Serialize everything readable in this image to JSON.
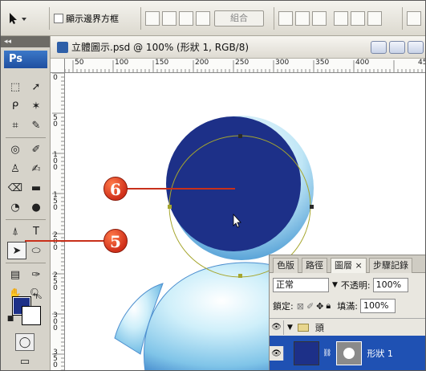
{
  "options_bar": {
    "show_bounding_box_label": "顯示邊界方框",
    "combine_label": "組合"
  },
  "document": {
    "title": "立體圖示.psd @ 100% (形狀 1, RGB/8)",
    "ruler_h_labels": [
      "50",
      "100",
      "150",
      "200",
      "250",
      "300",
      "350",
      "400",
      "45"
    ],
    "ruler_v_labels": [
      "0",
      "5\n0",
      "1\n0\n0",
      "1\n5\n0",
      "2\n0\n0",
      "2\n5\n0",
      "3\n0\n0",
      "3\n5\n0"
    ]
  },
  "toolbox": {
    "app_label": "Ps"
  },
  "colors": {
    "foreground": "#1d3088",
    "background": "#ffffff",
    "shape_fill": "#1d3088",
    "callout": "#d0301a"
  },
  "layers_panel": {
    "tabs": [
      "色版",
      "路徑",
      "圖層 ×",
      "步驟記錄"
    ],
    "blend_mode": "正常",
    "opacity_label": "不透明:",
    "opacity_value": "100%",
    "lock_label": "鎖定:",
    "fill_label": "填滿:",
    "fill_value": "100%",
    "group_name": "頭",
    "layer_name": "形狀 1"
  },
  "callouts": {
    "step6": "6",
    "step5": "5"
  }
}
